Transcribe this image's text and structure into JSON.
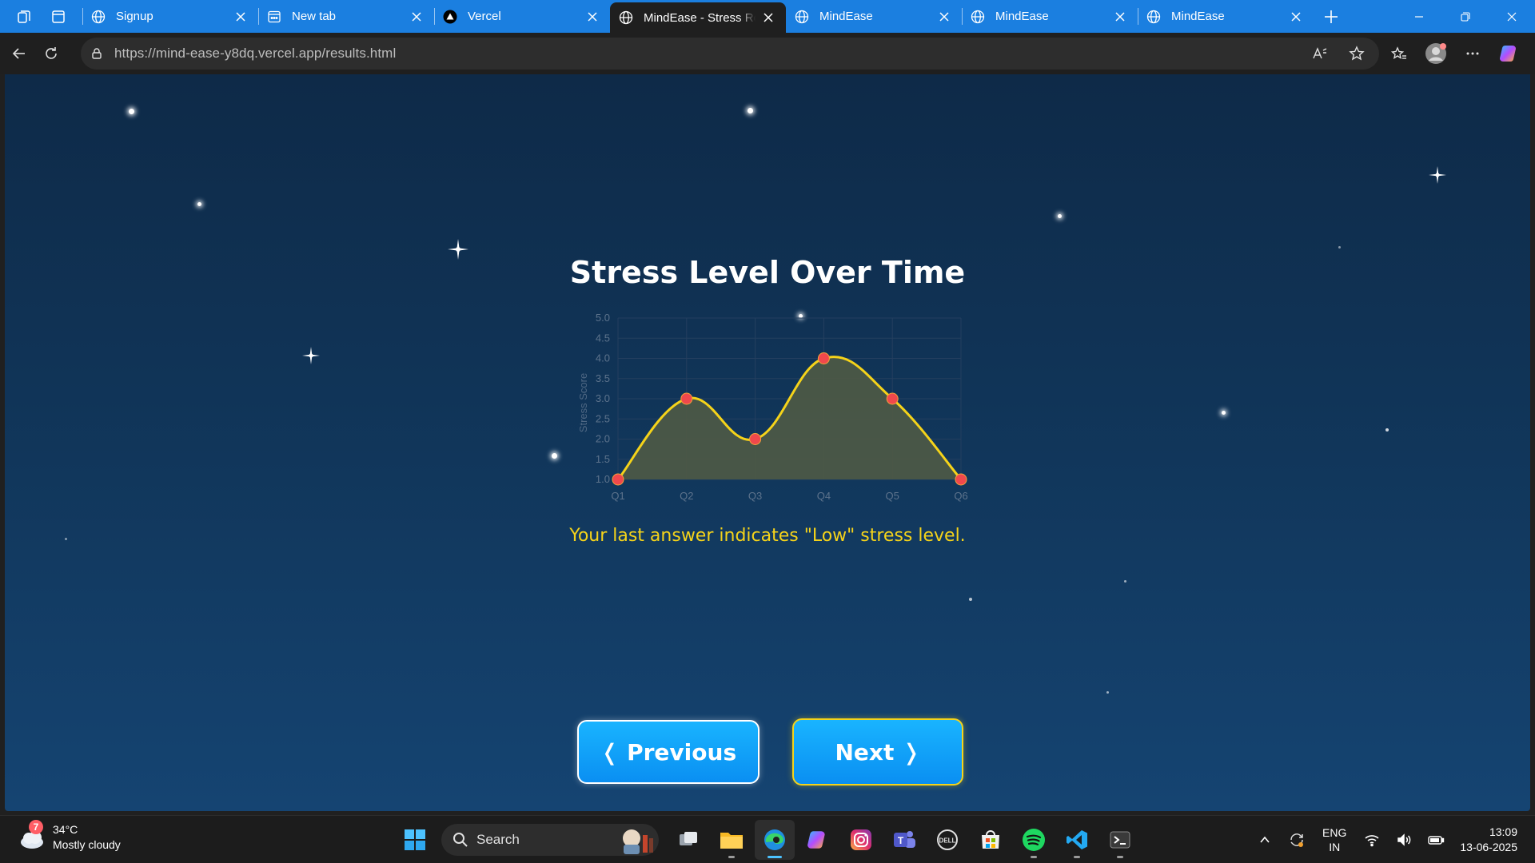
{
  "browser": {
    "tabs": [
      {
        "title": "Signup",
        "favicon": "globe-icon",
        "active": false
      },
      {
        "title": "New tab",
        "favicon": "newtab-icon",
        "active": false
      },
      {
        "title": "Vercel",
        "favicon": "vercel-icon",
        "active": false
      },
      {
        "title": "MindEase - Stress Res",
        "favicon": "globe-icon",
        "active": true
      },
      {
        "title": "MindEase",
        "favicon": "globe-icon",
        "active": false
      },
      {
        "title": "MindEase",
        "favicon": "globe-icon",
        "active": false
      },
      {
        "title": "MindEase",
        "favicon": "globe-icon",
        "active": false
      }
    ],
    "address": {
      "host": "https://mind-ease-y8dq.vercel.app",
      "path": "/results.html"
    }
  },
  "page": {
    "title": "Stress Level Over Time",
    "result_message": "Your last answer indicates \"Low\" stress level.",
    "prev_label": "❬ Previous",
    "next_label": "Next ❭"
  },
  "chart_data": {
    "type": "line",
    "categories": [
      "Q1",
      "Q2",
      "Q3",
      "Q4",
      "Q5",
      "Q6"
    ],
    "values": [
      1,
      3,
      2,
      4,
      3,
      1
    ],
    "ylabel": "Stress Score",
    "ylim": [
      1.0,
      5.0
    ],
    "yticks": [
      "1.0",
      "1.5",
      "2.0",
      "2.5",
      "3.0",
      "3.5",
      "4.0",
      "4.5",
      "5.0"
    ],
    "grid": true,
    "fill": true,
    "line_color": "#f5d31a",
    "point_color": "#f0484c",
    "fill_color": "#4f5a45"
  },
  "taskbar": {
    "weather": {
      "temp": "34°C",
      "desc": "Mostly cloudy",
      "badge": "7"
    },
    "search_placeholder": "Search",
    "lang": {
      "line1": "ENG",
      "line2": "IN"
    },
    "clock": {
      "time": "13:09",
      "date": "13-06-2025"
    }
  }
}
